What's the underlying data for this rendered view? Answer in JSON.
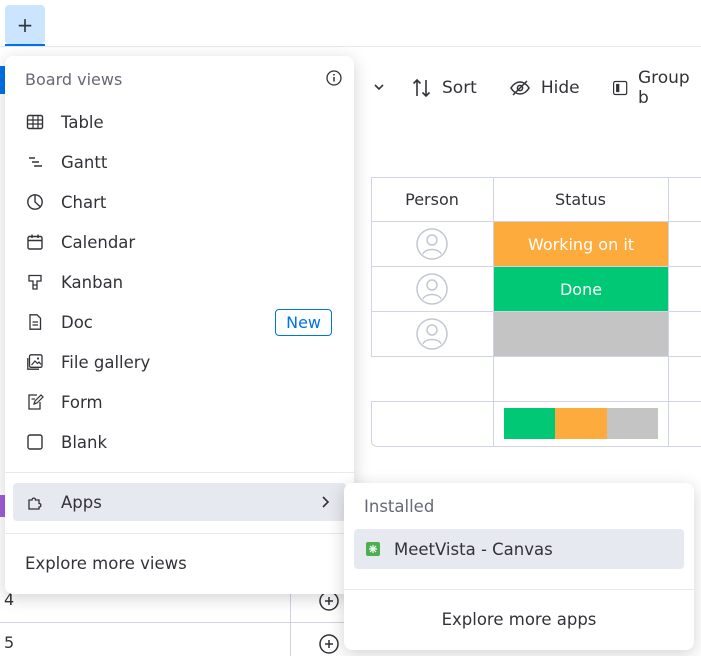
{
  "tabs": {
    "add_label": "+"
  },
  "toolbar": {
    "sort_label": "Sort",
    "hide_label": "Hide",
    "group_label": "Group b"
  },
  "table": {
    "columns": [
      "Person",
      "Status"
    ],
    "rows": [
      {
        "status": "Working on it",
        "status_color": "#fdab3d"
      },
      {
        "status": "Done",
        "status_color": "#00c875"
      },
      {
        "status": "",
        "status_color": "#c4c4c4"
      }
    ],
    "summary_colors": [
      "#00c875",
      "#fdab3d",
      "#c4c4c4"
    ],
    "bottom_row_numbers": [
      "4",
      "5"
    ]
  },
  "board_views": {
    "header": "Board views",
    "items": [
      {
        "label": "Table",
        "icon": "table-icon"
      },
      {
        "label": "Gantt",
        "icon": "gantt-icon"
      },
      {
        "label": "Chart",
        "icon": "chart-icon"
      },
      {
        "label": "Calendar",
        "icon": "calendar-icon"
      },
      {
        "label": "Kanban",
        "icon": "kanban-icon"
      },
      {
        "label": "Doc",
        "icon": "doc-icon",
        "badge": "New"
      },
      {
        "label": "File gallery",
        "icon": "file-gallery-icon"
      },
      {
        "label": "Form",
        "icon": "form-icon"
      },
      {
        "label": "Blank",
        "icon": "blank-icon"
      }
    ],
    "apps_label": "Apps",
    "explore_label": "Explore more views"
  },
  "apps_submenu": {
    "installed_label": "Installed",
    "app_name": "MeetVista - Canvas",
    "explore_label": "Explore more apps"
  },
  "colors": {
    "accent": "#0073ea",
    "highlight": "#e6e9ef"
  }
}
